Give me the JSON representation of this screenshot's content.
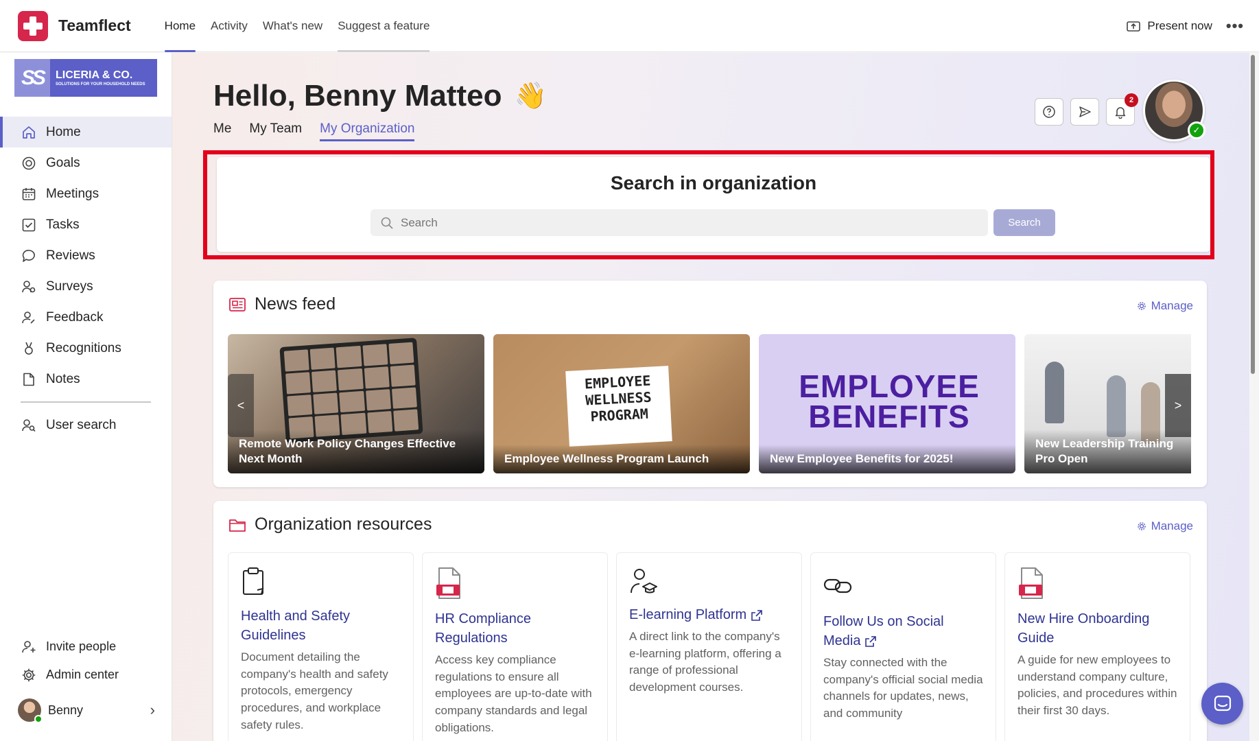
{
  "app": {
    "name": "Teamflect"
  },
  "top_tabs": [
    {
      "label": "Home"
    },
    {
      "label": "Activity"
    },
    {
      "label": "What's new"
    },
    {
      "label": "Suggest a feature"
    }
  ],
  "top_right": {
    "present_label": "Present now",
    "more_label": "•••"
  },
  "org_logo": {
    "mark": "SS",
    "name": "LICERIA & CO.",
    "tagline": "SOLUTIONS FOR YOUR HOUSEHOLD NEEDS"
  },
  "sidebar": {
    "items": [
      {
        "label": "Home",
        "icon": "home-icon"
      },
      {
        "label": "Goals",
        "icon": "goals-icon"
      },
      {
        "label": "Meetings",
        "icon": "calendar-icon"
      },
      {
        "label": "Tasks",
        "icon": "checkbox-icon"
      },
      {
        "label": "Reviews",
        "icon": "chat-bubble-icon"
      },
      {
        "label": "Surveys",
        "icon": "survey-icon"
      },
      {
        "label": "Feedback",
        "icon": "feedback-icon"
      },
      {
        "label": "Recognitions",
        "icon": "ribbon-icon"
      },
      {
        "label": "Notes",
        "icon": "note-icon"
      }
    ],
    "user_search": "User search",
    "invite": "Invite people",
    "admin": "Admin center",
    "user": "Benny"
  },
  "greeting": {
    "text": "Hello, Benny Matteo",
    "emoji": "👋"
  },
  "sub_tabs": [
    {
      "label": "Me"
    },
    {
      "label": "My Team"
    },
    {
      "label": "My Organization"
    }
  ],
  "notifications": {
    "count": "2"
  },
  "search": {
    "title": "Search in organization",
    "placeholder": "Search",
    "button": "Search"
  },
  "news": {
    "title": "News feed",
    "manage": "Manage",
    "prev": "<",
    "next": ">",
    "items": [
      {
        "caption": "Remote Work Policy Changes Effective Next Month"
      },
      {
        "caption": "Employee Wellness Program Launch",
        "image_text": "EMPLOYEE WELLNESS PROGRAM"
      },
      {
        "caption": "New Employee Benefits for 2025!",
        "image_text": "EMPLOYEE BENEFITS"
      },
      {
        "caption": "New Leadership Training Pro Open"
      }
    ]
  },
  "resources": {
    "title": "Organization resources",
    "manage": "Manage",
    "items": [
      {
        "title": "Health and Safety Guidelines",
        "desc": "Document detailing the company's health and safety protocols, emergency procedures, and workplace safety rules."
      },
      {
        "title": "HR Compliance Regulations",
        "desc": "Access key compliance regulations to ensure all employees are up-to-date with company standards and legal obligations."
      },
      {
        "title": "E-learning Platform",
        "desc": "A direct link to the company's e-learning platform, offering a range of professional development courses."
      },
      {
        "title": "Follow Us on Social Media",
        "desc": "Stay connected with the company's official social media channels for updates, news, and community"
      },
      {
        "title": "New Hire Onboarding Guide",
        "desc": "A guide for new employees to understand company culture, policies, and procedures within their first 30 days."
      }
    ]
  },
  "colors": {
    "brand": "#d6264b",
    "accent": "#5b5fc7",
    "highlight_frame": "#e3001b"
  }
}
